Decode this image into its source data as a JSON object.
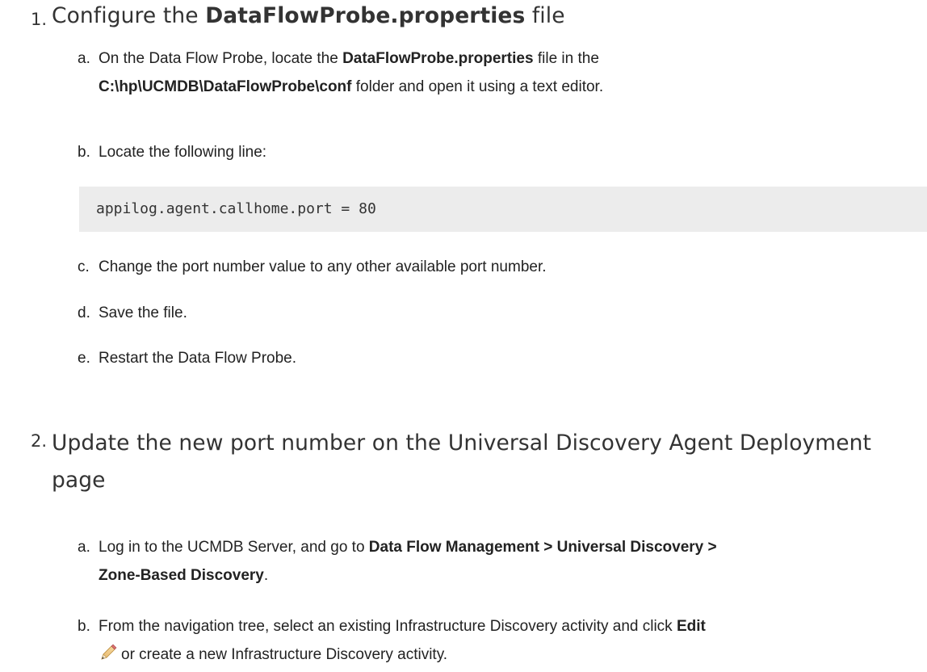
{
  "step1": {
    "number": "1.",
    "title_prefix": "Configure the ",
    "title_bold": "DataFlowProbe.properties",
    "title_suffix": " file",
    "a": {
      "letter": "a.",
      "t1": "On the Data Flow Probe, locate the ",
      "b1": "DataFlowProbe.properties",
      "t2": " file in the",
      "b2": "C:\\hp\\UCMDB\\DataFlowProbe\\conf",
      "t3": " folder and open it using a text editor."
    },
    "b": {
      "letter": "b.",
      "text": "Locate the following line:"
    },
    "code": "appilog.agent.callhome.port = 80",
    "c": {
      "letter": "c.",
      "text": "Change the port number value to any other available port number."
    },
    "d": {
      "letter": "d.",
      "text": "Save the file."
    },
    "e": {
      "letter": "e.",
      "text": "Restart the Data Flow Probe."
    }
  },
  "step2": {
    "number": "2.",
    "title_line1": "Update the new port number on the Universal Discovery Agent Deployment",
    "title_line2": "page",
    "a": {
      "letter": "a.",
      "t1": "Log in to the UCMDB Server, and go to ",
      "b1": "Data Flow Management > Universal Discovery >",
      "b2": "Zone-Based Discovery",
      "t2": "."
    },
    "b": {
      "letter": "b.",
      "t1": "From the navigation tree, select an existing Infrastructure Discovery activity and click ",
      "b1": "Edit",
      "t2": "or create a new Infrastructure Discovery activity.",
      "icon": "pencil-edit-icon"
    }
  }
}
